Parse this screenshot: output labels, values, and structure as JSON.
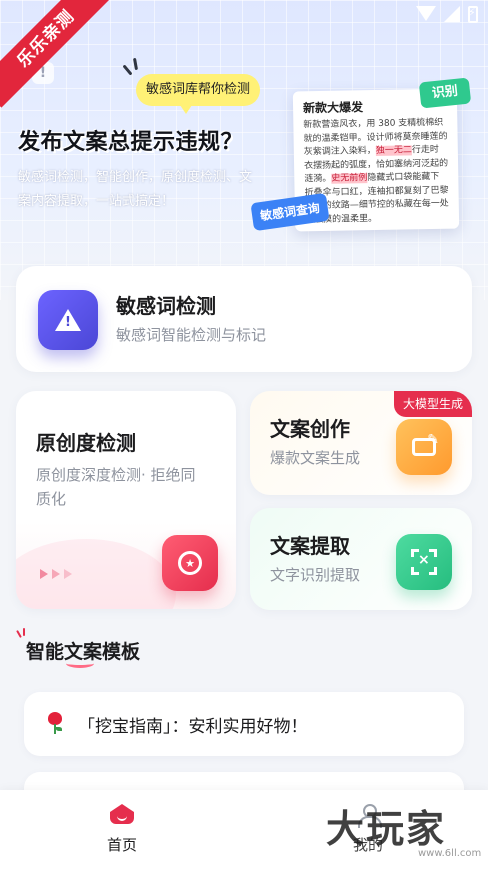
{
  "status_bar": {
    "icons": [
      "wifi-icon",
      "signal-icon",
      "battery-charging-icon"
    ]
  },
  "ribbon": {
    "label": "乐乐亲测"
  },
  "hero": {
    "bubble": "敏感词库帮你检测",
    "title": "发布文案总提示违规？",
    "description": "敏感词检测，智能创作，原创度检测、文案内容提取，一站式搞定！",
    "paper": {
      "title": "新款大爆发",
      "body_before": "新款营造风衣，用 380 支精梳棉织就的温柔铠甲。设计师将莫奈睡莲的灰紫调注入染料，",
      "highlight_1": "独一无二",
      "body_middle": "行走时衣摆扬起的弧度，恰如塞纳河泛起的涟漪。",
      "highlight_2": "史无前例",
      "body_after": "隐藏式口袋能藏下折叠伞与口红，连袖扣都复刻了巴黎铜锁的纹路—细节控的私藏在每一处可触摸的温柔里。"
    },
    "tag_recognize": "识别",
    "tag_sensitive_query": "敏感词查询"
  },
  "features": {
    "sensitive": {
      "title": "敏感词检测",
      "subtitle": "敏感词智能检测与标记",
      "icon": "warning-icon"
    },
    "originality": {
      "title": "原创度检测",
      "subtitle": "原创度深度检测· 拒绝同质化",
      "icon": "medal-icon"
    },
    "writing": {
      "title": "文案创作",
      "subtitle": "爆款文案生成",
      "badge": "大模型生成",
      "icon": "edit-icon"
    },
    "extract": {
      "title": "文案提取",
      "subtitle": "文字识别提取",
      "icon": "scan-text-icon"
    }
  },
  "templates": {
    "section_title": "智能文案模板",
    "items": [
      {
        "icon": "rose-icon",
        "text": "「挖宝指南」：安利实用好物！"
      },
      {
        "text": ""
      }
    ]
  },
  "tabbar": {
    "home": {
      "label": "首页",
      "icon": "home-icon"
    },
    "mine": {
      "label": "我的",
      "icon": "user-icon"
    }
  },
  "watermark": {
    "logo": "大玩家",
    "url": "www.6ll.com"
  },
  "colors": {
    "accent_red": "#e52e4d",
    "purple": "#4b47d6",
    "orange": "#ff9a2e",
    "green": "#26bd7f",
    "highlight_yellow": "#fff176",
    "tag_green": "#2fc98e",
    "tag_blue": "#3b82f6"
  }
}
